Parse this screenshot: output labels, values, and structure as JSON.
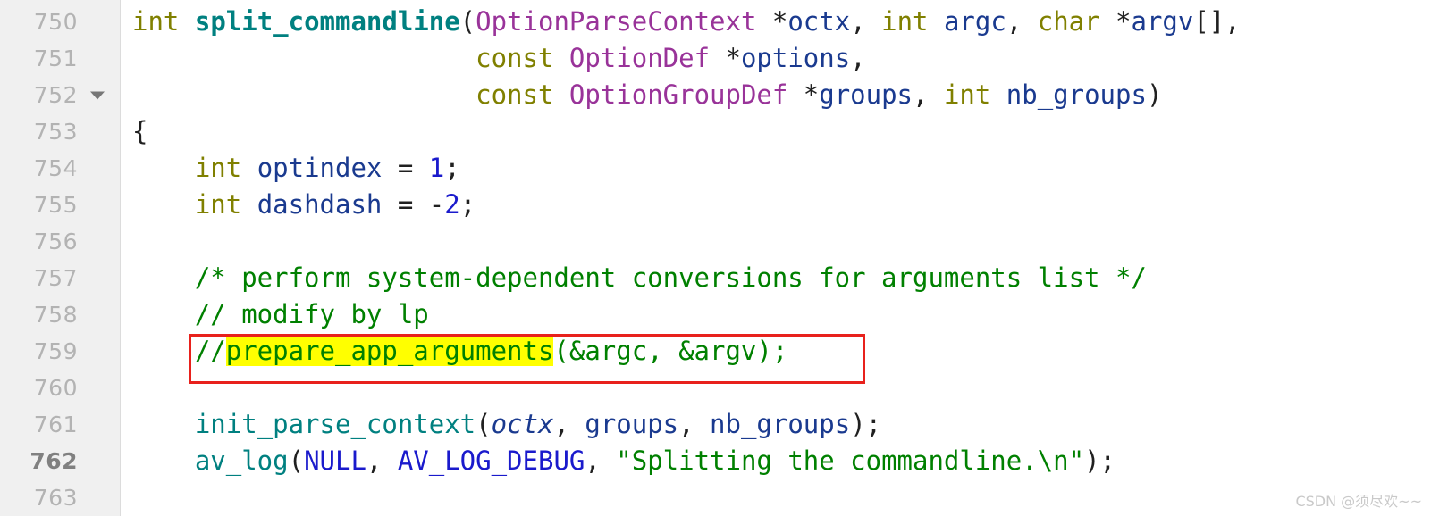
{
  "editor": {
    "language": "C",
    "font_size_px": 29,
    "line_height_px": 41,
    "gutter_bg": "#f0f0f0",
    "background": "#ffffff",
    "current_line": 762,
    "first_visible_line": 750,
    "last_visible_line": 763
  },
  "gutter": {
    "line_numbers": [
      "750",
      "751",
      "752",
      "753",
      "754",
      "755",
      "756",
      "757",
      "758",
      "759",
      "760",
      "761",
      "762",
      "763"
    ],
    "fold_marker_line": "752",
    "fold_icon": "chevron-down-icon"
  },
  "annotation": {
    "red_box_color": "#e8211c",
    "red_box_target_line": "759",
    "highlight_color": "#ffff00",
    "highlight_text": "prepare_app_arguments"
  },
  "lines": [
    {
      "number": "750",
      "tokens": [
        {
          "t": "int",
          "c": "kw"
        },
        {
          "t": " ",
          "c": "punct"
        },
        {
          "t": "split_commandline",
          "c": "fnb"
        },
        {
          "t": "(",
          "c": "punct"
        },
        {
          "t": "OptionParseContext",
          "c": "type"
        },
        {
          "t": " *",
          "c": "punct"
        },
        {
          "t": "octx",
          "c": "ident"
        },
        {
          "t": ", ",
          "c": "punct"
        },
        {
          "t": "int",
          "c": "kw"
        },
        {
          "t": " ",
          "c": "punct"
        },
        {
          "t": "argc",
          "c": "ident"
        },
        {
          "t": ", ",
          "c": "punct"
        },
        {
          "t": "char",
          "c": "kw"
        },
        {
          "t": " *",
          "c": "punct"
        },
        {
          "t": "argv",
          "c": "ident"
        },
        {
          "t": "[],",
          "c": "punct"
        }
      ]
    },
    {
      "number": "751",
      "tokens": [
        {
          "t": "                      ",
          "c": "punct"
        },
        {
          "t": "const",
          "c": "kw"
        },
        {
          "t": " ",
          "c": "punct"
        },
        {
          "t": "OptionDef",
          "c": "type"
        },
        {
          "t": " *",
          "c": "punct"
        },
        {
          "t": "options",
          "c": "ident"
        },
        {
          "t": ",",
          "c": "punct"
        }
      ]
    },
    {
      "number": "752",
      "tokens": [
        {
          "t": "                      ",
          "c": "punct"
        },
        {
          "t": "const",
          "c": "kw"
        },
        {
          "t": " ",
          "c": "punct"
        },
        {
          "t": "OptionGroupDef",
          "c": "type"
        },
        {
          "t": " *",
          "c": "punct"
        },
        {
          "t": "groups",
          "c": "ident"
        },
        {
          "t": ", ",
          "c": "punct"
        },
        {
          "t": "int",
          "c": "kw"
        },
        {
          "t": " ",
          "c": "punct"
        },
        {
          "t": "nb_groups",
          "c": "ident"
        },
        {
          "t": ")",
          "c": "punct"
        }
      ]
    },
    {
      "number": "753",
      "tokens": [
        {
          "t": "{",
          "c": "punct"
        }
      ]
    },
    {
      "number": "754",
      "tokens": [
        {
          "t": "    ",
          "c": "punct"
        },
        {
          "t": "int",
          "c": "kw"
        },
        {
          "t": " ",
          "c": "punct"
        },
        {
          "t": "optindex",
          "c": "ident"
        },
        {
          "t": " = ",
          "c": "punct"
        },
        {
          "t": "1",
          "c": "num"
        },
        {
          "t": ";",
          "c": "punct"
        }
      ]
    },
    {
      "number": "755",
      "tokens": [
        {
          "t": "    ",
          "c": "punct"
        },
        {
          "t": "int",
          "c": "kw"
        },
        {
          "t": " ",
          "c": "punct"
        },
        {
          "t": "dashdash",
          "c": "ident"
        },
        {
          "t": " = ",
          "c": "punct"
        },
        {
          "t": "-",
          "c": "punct"
        },
        {
          "t": "2",
          "c": "num"
        },
        {
          "t": ";",
          "c": "punct"
        }
      ]
    },
    {
      "number": "756",
      "tokens": []
    },
    {
      "number": "757",
      "tokens": [
        {
          "t": "    ",
          "c": "punct"
        },
        {
          "t": "/* perform system-dependent conversions for arguments list */",
          "c": "cmt"
        }
      ]
    },
    {
      "number": "758",
      "tokens": [
        {
          "t": "    ",
          "c": "punct"
        },
        {
          "t": "// modify by lp",
          "c": "cmt"
        }
      ]
    },
    {
      "number": "759",
      "tokens": [
        {
          "t": "    ",
          "c": "punct"
        },
        {
          "t": "//",
          "c": "cmt"
        },
        {
          "t": "prepare_app_arguments",
          "c": "cmt hl"
        },
        {
          "t": "(&argc, &argv);",
          "c": "cmt"
        }
      ]
    },
    {
      "number": "760",
      "tokens": []
    },
    {
      "number": "761",
      "tokens": [
        {
          "t": "    ",
          "c": "punct"
        },
        {
          "t": "init_parse_context",
          "c": "fn"
        },
        {
          "t": "(",
          "c": "punct"
        },
        {
          "t": "octx",
          "c": "ident ital"
        },
        {
          "t": ", ",
          "c": "punct"
        },
        {
          "t": "groups",
          "c": "ident"
        },
        {
          "t": ", ",
          "c": "punct"
        },
        {
          "t": "nb_groups",
          "c": "ident"
        },
        {
          "t": ");",
          "c": "punct"
        }
      ]
    },
    {
      "number": "762",
      "tokens": [
        {
          "t": "    ",
          "c": "punct"
        },
        {
          "t": "av_log",
          "c": "fn"
        },
        {
          "t": "(",
          "c": "punct"
        },
        {
          "t": "NULL",
          "c": "macro"
        },
        {
          "t": ", ",
          "c": "punct"
        },
        {
          "t": "AV_LOG_DEBUG",
          "c": "macro"
        },
        {
          "t": ", ",
          "c": "punct"
        },
        {
          "t": "\"Splitting the commandline.\\n\"",
          "c": "str"
        },
        {
          "t": ");",
          "c": "punct"
        }
      ]
    },
    {
      "number": "763",
      "tokens": []
    }
  ],
  "watermark": {
    "text": "CSDN @须尽欢~~"
  }
}
